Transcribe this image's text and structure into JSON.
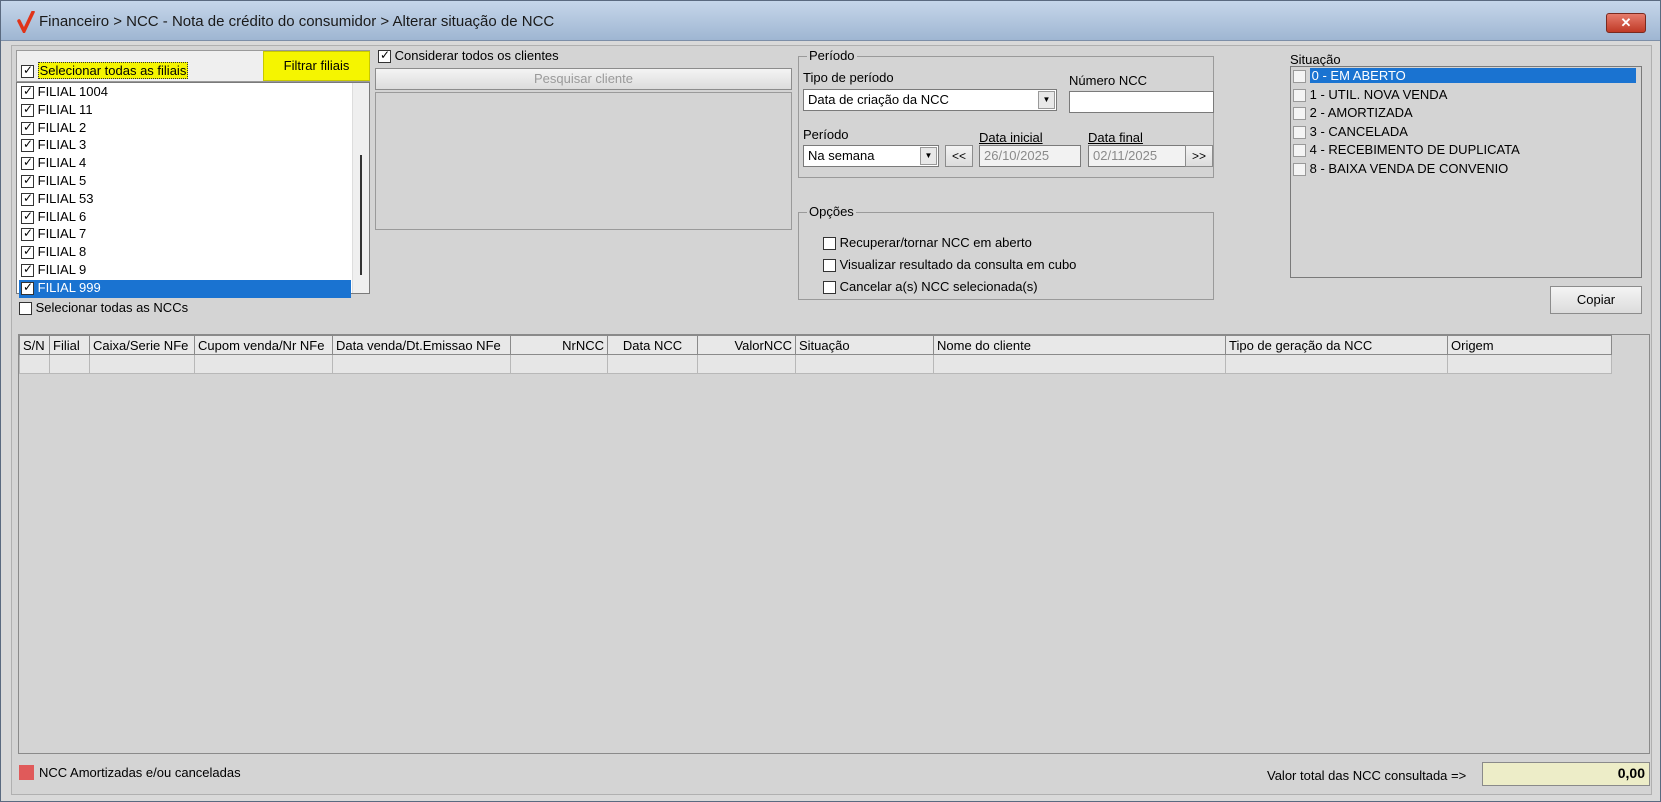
{
  "window": {
    "title": "Financeiro > NCC - Nota de crédito do consumidor > Alterar situação de NCC",
    "close_label": "✕"
  },
  "filiais": {
    "select_all_label": "Selecionar todas as filiais",
    "filter_button": "Filtrar filiais",
    "items": [
      "FILIAL 1004",
      "FILIAL 11",
      "FILIAL 2",
      "FILIAL 3",
      "FILIAL 4",
      "FILIAL 5",
      "FILIAL 53",
      "FILIAL 6",
      "FILIAL 7",
      "FILIAL 8",
      "FILIAL 9",
      "FILIAL 999"
    ],
    "selected_item": "FILIAL 999"
  },
  "clientes": {
    "consider_all_label": "Considerar todos os clientes",
    "search_button": "Pesquisar cliente"
  },
  "periodo": {
    "legend": "Período",
    "tipo_label": "Tipo de período",
    "tipo_value": "Data de criação da NCC",
    "numero_label": "Número NCC",
    "numero_value": "",
    "periodo_label": "Período",
    "periodo_value": "Na semana",
    "prev_button": "<<",
    "next_button": ">>",
    "data_inicial_label": "Data inicial",
    "data_inicial_value": "26/10/2025",
    "data_final_label": "Data final",
    "data_final_value": "02/11/2025"
  },
  "opcoes": {
    "legend": "Opções",
    "items": [
      "Recuperar/tornar NCC em aberto",
      "Visualizar resultado da consulta em cubo",
      "Cancelar a(s) NCC selecionada(s)"
    ]
  },
  "situacao": {
    "label": "Situação",
    "items": [
      "0 - EM ABERTO",
      "1 - UTIL. NOVA VENDA",
      "2 - AMORTIZADA",
      "3 - CANCELADA",
      "4 - RECEBIMENTO DE DUPLICATA",
      "8 - BAIXA VENDA DE CONVENIO"
    ],
    "selected_item": "0 - EM ABERTO"
  },
  "copy_button": "Copiar",
  "grid": {
    "select_all_label": "Selecionar todas as NCCs",
    "columns": [
      "S/N",
      "Filial",
      "Caixa/Serie NFe",
      "Cupom venda/Nr NFe",
      "Data venda/Dt.Emissao NFe",
      "NrNCC",
      "Data NCC",
      "ValorNCC",
      "Situação",
      "Nome do cliente",
      "Tipo de geração da NCC",
      "Origem"
    ]
  },
  "footer": {
    "legend_label": "NCC Amortizadas e/ou canceladas",
    "legend_color": "#e05a5a",
    "total_label": "Valor total das NCC consultada =>",
    "total_value": "0,00"
  },
  "colors": {
    "highlight_yellow": "#f5f500",
    "selection_blue": "#1a73d1"
  }
}
